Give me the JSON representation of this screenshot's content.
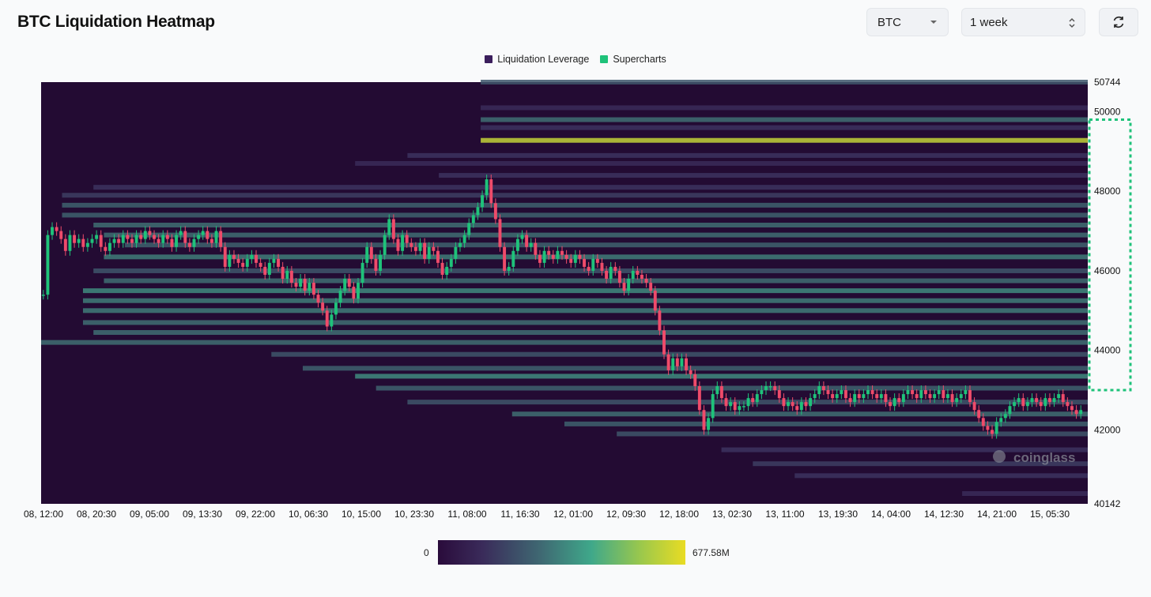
{
  "header": {
    "title": "BTC Liquidation Heatmap",
    "coin_select_value": "BTC",
    "range_select_value": "1 week",
    "refresh_icon": "refresh-icon"
  },
  "legend": {
    "items": [
      {
        "label": "Liquidation Leverage",
        "color": "#3b1e5c"
      },
      {
        "label": "Supercharts",
        "color": "#1fc27a"
      }
    ]
  },
  "colorbar": {
    "min_label": "0",
    "max_label": "677.58M",
    "colors": [
      "#2a0b3b",
      "#3f6a73",
      "#3fa88a",
      "#e9dc23"
    ]
  },
  "watermark": "coinglass",
  "chart_data": {
    "type": "heatmap",
    "title": "BTC Liquidation Heatmap",
    "x_ticks": [
      "08, 12:00",
      "08, 20:30",
      "09, 05:00",
      "09, 13:30",
      "09, 22:00",
      "10, 06:30",
      "10, 15:00",
      "10, 23:30",
      "11, 08:00",
      "11, 16:30",
      "12, 01:00",
      "12, 09:30",
      "12, 18:00",
      "13, 02:30",
      "13, 11:00",
      "13, 19:30",
      "14, 04:00",
      "14, 12:30",
      "14, 21:00",
      "15, 05:30"
    ],
    "y_ticks": [
      50744,
      50000,
      48000,
      46000,
      44000,
      42000,
      40142
    ],
    "ylim": [
      40142,
      50744
    ],
    "grid": false,
    "legend_position": "top-center",
    "price_series": {
      "name": "Supercharts",
      "interval_hours": 1,
      "close": [
        45400,
        46900,
        47100,
        47000,
        46800,
        46500,
        46900,
        46700,
        46800,
        46600,
        46700,
        46800,
        46900,
        46600,
        46500,
        46700,
        46800,
        46700,
        46900,
        46800,
        46700,
        46900,
        46800,
        47000,
        46900,
        46800,
        46700,
        46900,
        46800,
        46600,
        46900,
        47000,
        46700,
        46600,
        46800,
        46900,
        47000,
        46800,
        46700,
        47000,
        46600,
        46100,
        46400,
        46300,
        46200,
        46100,
        46300,
        46400,
        46200,
        46100,
        45900,
        46200,
        46300,
        46100,
        45800,
        46000,
        45700,
        45600,
        45800,
        45500,
        45700,
        45400,
        45200,
        45000,
        44600,
        44900,
        45200,
        45500,
        45800,
        45600,
        45300,
        45700,
        46200,
        46600,
        46300,
        46000,
        46400,
        46900,
        47300,
        46800,
        46500,
        46900,
        46700,
        46600,
        46500,
        46700,
        46300,
        46600,
        46500,
        46200,
        45900,
        46100,
        46300,
        46600,
        46700,
        46900,
        47200,
        47400,
        47600,
        47900,
        48300,
        47700,
        47300,
        46600,
        46000,
        46100,
        46500,
        46800,
        46900,
        46600,
        46700,
        46400,
        46200,
        46500,
        46400,
        46300,
        46500,
        46400,
        46300,
        46200,
        46400,
        46300,
        46100,
        46000,
        46300,
        46200,
        46000,
        45800,
        46100,
        46000,
        45700,
        45500,
        45800,
        46000,
        45900,
        45800,
        45700,
        45500,
        45000,
        44500,
        43900,
        43500,
        43800,
        43600,
        43800,
        43500,
        43400,
        43100,
        42500,
        42000,
        42300,
        42900,
        43100,
        42800,
        42600,
        42700,
        42500,
        42600,
        42600,
        42800,
        42700,
        42900,
        43000,
        43100,
        43100,
        43000,
        42800,
        42600,
        42700,
        42600,
        42500,
        42700,
        42600,
        42800,
        42900,
        43100,
        43000,
        42900,
        42800,
        42900,
        43000,
        42800,
        42700,
        42900,
        42800,
        42900,
        43000,
        42900,
        42800,
        42900,
        42700,
        42600,
        42800,
        42700,
        42900,
        43000,
        42900,
        42800,
        43000,
        42900,
        42800,
        42900,
        43000,
        42800,
        42900,
        42700,
        42800,
        42900,
        43000,
        42700,
        42500,
        42300,
        42100,
        42000,
        41900,
        42200,
        42300,
        42400,
        42600,
        42700,
        42800,
        42600,
        42700,
        42800,
        42700,
        42600,
        42800,
        42700,
        42800,
        42900,
        42700,
        42600,
        42500,
        42400,
        42500
      ]
    },
    "liquidation_bands": [
      {
        "price": 50744,
        "start": 0.42,
        "end": 1.0,
        "intensity": 0.45
      },
      {
        "price": 50100,
        "start": 0.42,
        "end": 1.0,
        "intensity": 0.25
      },
      {
        "price": 49800,
        "start": 0.42,
        "end": 1.0,
        "intensity": 0.55
      },
      {
        "price": 49600,
        "start": 0.42,
        "end": 1.0,
        "intensity": 0.3
      },
      {
        "price": 49280,
        "start": 0.42,
        "end": 1.0,
        "intensity": 0.95
      },
      {
        "price": 48900,
        "start": 0.35,
        "end": 1.0,
        "intensity": 0.3
      },
      {
        "price": 48700,
        "start": 0.3,
        "end": 1.0,
        "intensity": 0.25
      },
      {
        "price": 48400,
        "start": 0.38,
        "end": 1.0,
        "intensity": 0.3
      },
      {
        "price": 48100,
        "start": 0.05,
        "end": 1.0,
        "intensity": 0.3
      },
      {
        "price": 47900,
        "start": 0.02,
        "end": 1.0,
        "intensity": 0.35
      },
      {
        "price": 47650,
        "start": 0.02,
        "end": 1.0,
        "intensity": 0.5
      },
      {
        "price": 47400,
        "start": 0.02,
        "end": 1.0,
        "intensity": 0.5
      },
      {
        "price": 47150,
        "start": 0.05,
        "end": 1.0,
        "intensity": 0.55
      },
      {
        "price": 46900,
        "start": 0.06,
        "end": 1.0,
        "intensity": 0.55
      },
      {
        "price": 46650,
        "start": 0.08,
        "end": 1.0,
        "intensity": 0.5
      },
      {
        "price": 46350,
        "start": 0.06,
        "end": 1.0,
        "intensity": 0.6
      },
      {
        "price": 46000,
        "start": 0.05,
        "end": 1.0,
        "intensity": 0.45
      },
      {
        "price": 45750,
        "start": 0.06,
        "end": 1.0,
        "intensity": 0.55
      },
      {
        "price": 45500,
        "start": 0.04,
        "end": 1.0,
        "intensity": 0.65
      },
      {
        "price": 45250,
        "start": 0.04,
        "end": 1.0,
        "intensity": 0.6
      },
      {
        "price": 45000,
        "start": 0.04,
        "end": 1.0,
        "intensity": 0.6
      },
      {
        "price": 44700,
        "start": 0.04,
        "end": 1.0,
        "intensity": 0.55
      },
      {
        "price": 44450,
        "start": 0.05,
        "end": 1.0,
        "intensity": 0.55
      },
      {
        "price": 44200,
        "start": 0.0,
        "end": 1.0,
        "intensity": 0.55
      },
      {
        "price": 43900,
        "start": 0.22,
        "end": 1.0,
        "intensity": 0.45
      },
      {
        "price": 43550,
        "start": 0.25,
        "end": 1.0,
        "intensity": 0.5
      },
      {
        "price": 43350,
        "start": 0.3,
        "end": 1.0,
        "intensity": 0.65
      },
      {
        "price": 43050,
        "start": 0.32,
        "end": 1.0,
        "intensity": 0.5
      },
      {
        "price": 42700,
        "start": 0.35,
        "end": 1.0,
        "intensity": 0.45
      },
      {
        "price": 42400,
        "start": 0.45,
        "end": 1.0,
        "intensity": 0.55
      },
      {
        "price": 42150,
        "start": 0.5,
        "end": 1.0,
        "intensity": 0.5
      },
      {
        "price": 41900,
        "start": 0.55,
        "end": 1.0,
        "intensity": 0.45
      },
      {
        "price": 41500,
        "start": 0.65,
        "end": 1.0,
        "intensity": 0.3
      },
      {
        "price": 41150,
        "start": 0.68,
        "end": 1.0,
        "intensity": 0.35
      },
      {
        "price": 40850,
        "start": 0.72,
        "end": 1.0,
        "intensity": 0.3
      },
      {
        "price": 40400,
        "start": 0.88,
        "end": 1.0,
        "intensity": 0.25
      }
    ],
    "highlight_range": [
      43000,
      49800
    ]
  }
}
